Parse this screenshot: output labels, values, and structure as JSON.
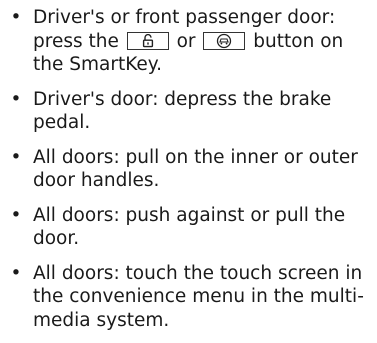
{
  "items": [
    {
      "before": "Driver's or front passenger door: press the ",
      "key1_icon": "unlock-icon",
      "between": " or ",
      "key2_icon": "car-icon",
      "after": " button on the SmartKey."
    },
    {
      "text": "Driver's door: depress the brake pedal."
    },
    {
      "text": "All doors: pull on the inner or outer door handles."
    },
    {
      "text": "All doors: push against or pull the door."
    },
    {
      "text": "All doors: touch the touch screen in the convenience menu in the multi­media system."
    }
  ],
  "bullet_glyph": "•"
}
